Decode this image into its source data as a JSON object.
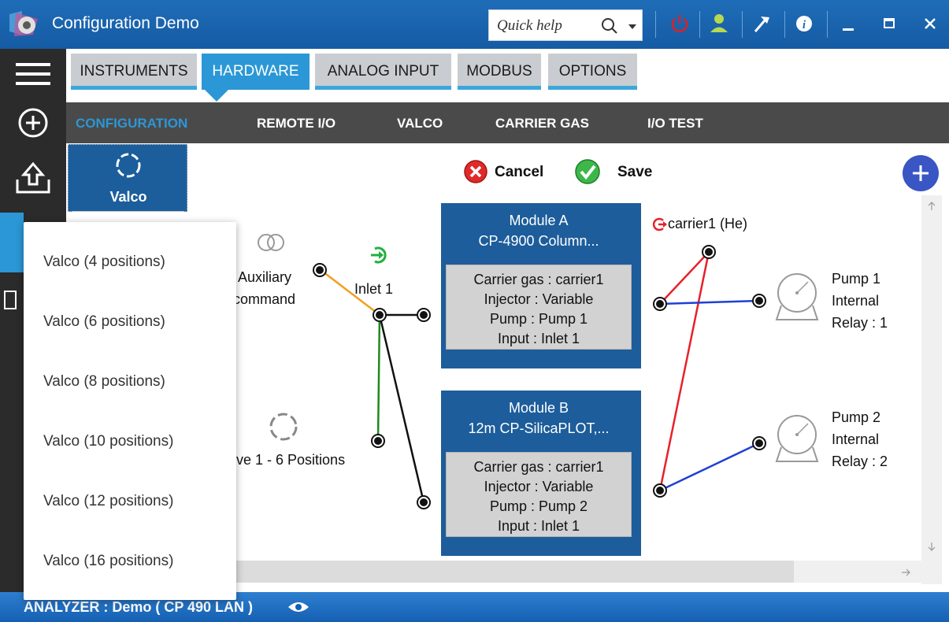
{
  "titlebar": {
    "app_title": "Configuration Demo",
    "quick_help_placeholder": "Quick help"
  },
  "tabs": [
    {
      "label": "INSTRUMENTS",
      "active": false
    },
    {
      "label": "HARDWARE",
      "active": true
    },
    {
      "label": "ANALOG INPUT",
      "active": false
    },
    {
      "label": "MODBUS",
      "active": false
    },
    {
      "label": "OPTIONS",
      "active": false
    }
  ],
  "subnav": [
    {
      "label": "CONFIGURATION",
      "active": true
    },
    {
      "label": "REMOTE I/O",
      "active": false
    },
    {
      "label": "VALCO",
      "active": false
    },
    {
      "label": "CARRIER GAS",
      "active": false
    },
    {
      "label": "I/O TEST",
      "active": false
    }
  ],
  "valco_tile": {
    "label": "Valco"
  },
  "actions": {
    "cancel_label": "Cancel",
    "save_label": "Save"
  },
  "modules": [
    {
      "title": "Module A",
      "subtitle": "CP-4900 Column...",
      "lines": [
        "Carrier gas : carrier1",
        "Injector : Variable",
        "Pump : Pump 1",
        "Input : Inlet 1"
      ]
    },
    {
      "title": "Module B",
      "subtitle": "12m CP-SilicaPLOT,...",
      "lines": [
        "Carrier gas : carrier1",
        "Injector : Variable",
        "Pump : Pump 2",
        "Input : Inlet 1"
      ]
    }
  ],
  "nodes": {
    "auxiliary_label_1": "Auxiliary",
    "auxiliary_label_2": "command",
    "inlet_label": "Inlet 1",
    "valve_label": "ve 1 - 6 Positions",
    "carrier_label": "carrier1 (He)",
    "pump1": [
      "Pump 1",
      "Internal",
      "Relay : 1"
    ],
    "pump2": [
      "Pump 2",
      "Internal",
      "Relay : 2"
    ]
  },
  "valco_menu": [
    "Valco (4 positions)",
    "Valco (6 positions)",
    "Valco (8 positions)",
    "Valco (10 positions)",
    "Valco (12 positions)",
    "Valco (16 positions)"
  ],
  "status": {
    "text": "ANALYZER :  Demo ( CP 490 LAN )"
  },
  "colors": {
    "title_blue": "#1f6db8",
    "tab_active": "#2b97d6",
    "module_blue": "#1d5d9b",
    "line_red": "#e8202a",
    "line_blue": "#1f3fd6",
    "line_green": "#1d8a1d",
    "line_orange": "#f0a020",
    "fab": "#3a55c4"
  }
}
